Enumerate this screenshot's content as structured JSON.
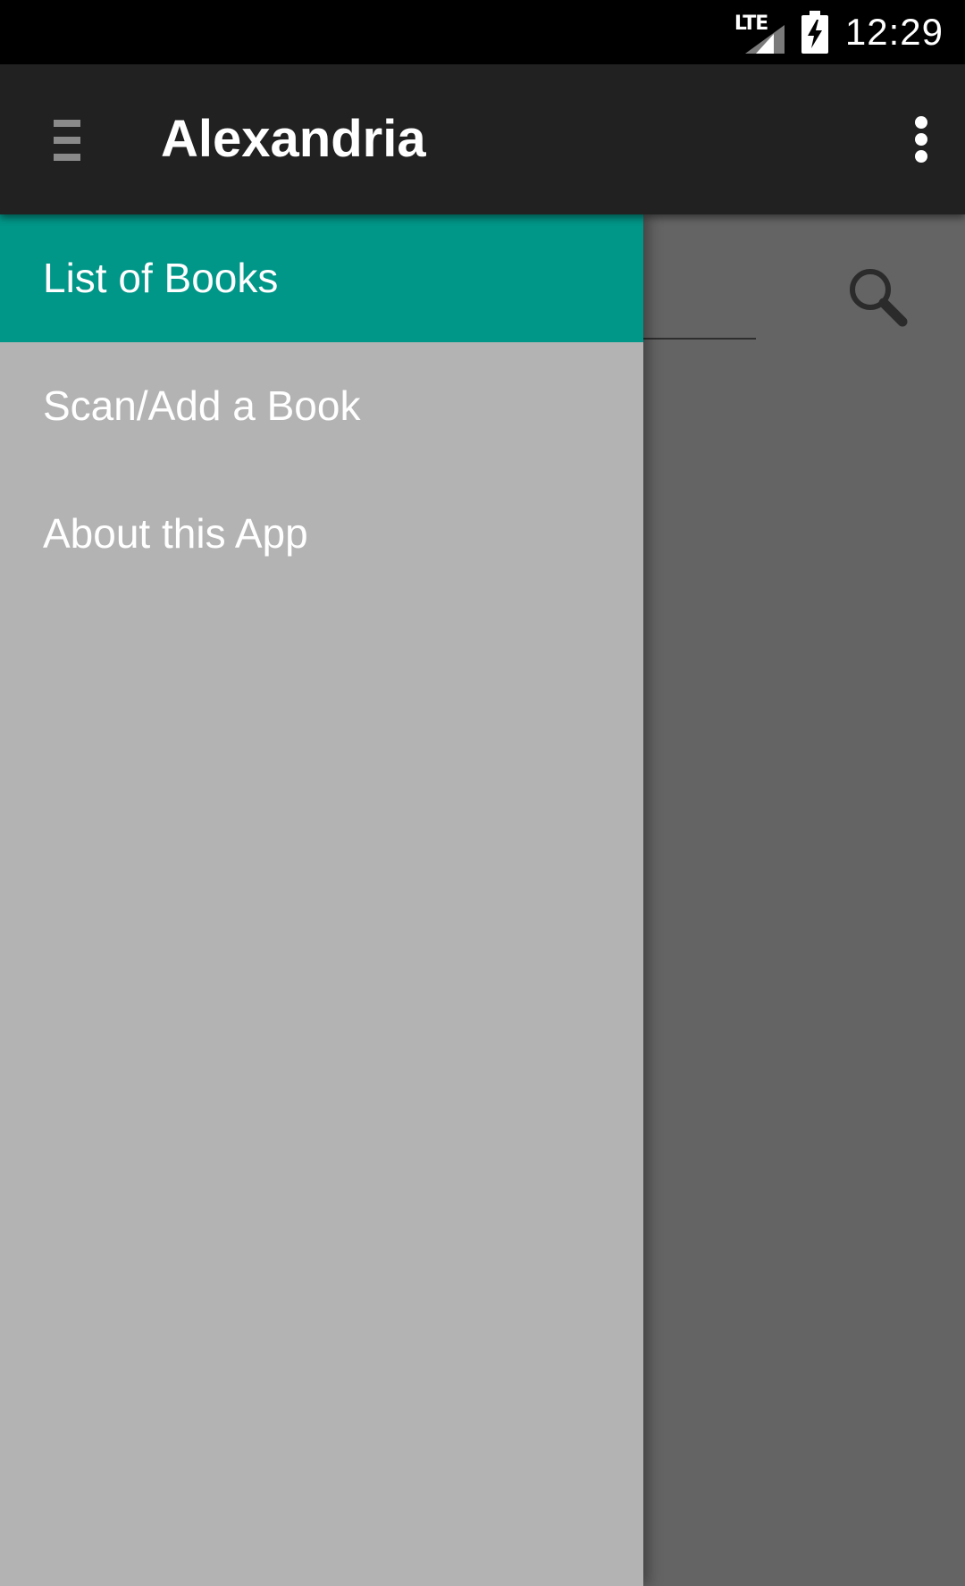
{
  "status_bar": {
    "network": "LTE",
    "time": "12:29",
    "icons": [
      "lte-signal-icon",
      "battery-charging-icon"
    ]
  },
  "app_bar": {
    "title": "Alexandria",
    "icons": [
      "menu-icon",
      "overflow-menu-icon"
    ]
  },
  "drawer": {
    "items": [
      {
        "label": "List of Books",
        "selected": true
      },
      {
        "label": "Scan/Add a Book",
        "selected": false
      },
      {
        "label": "About this App",
        "selected": false
      }
    ]
  },
  "background_content": {
    "icons": [
      "search-icon"
    ]
  },
  "colors": {
    "status_bar": "#000000",
    "app_bar": "#212121",
    "accent": "#009688",
    "drawer_bg": "#b3b3b3",
    "scrim": "#646464",
    "text": "#ffffff"
  }
}
